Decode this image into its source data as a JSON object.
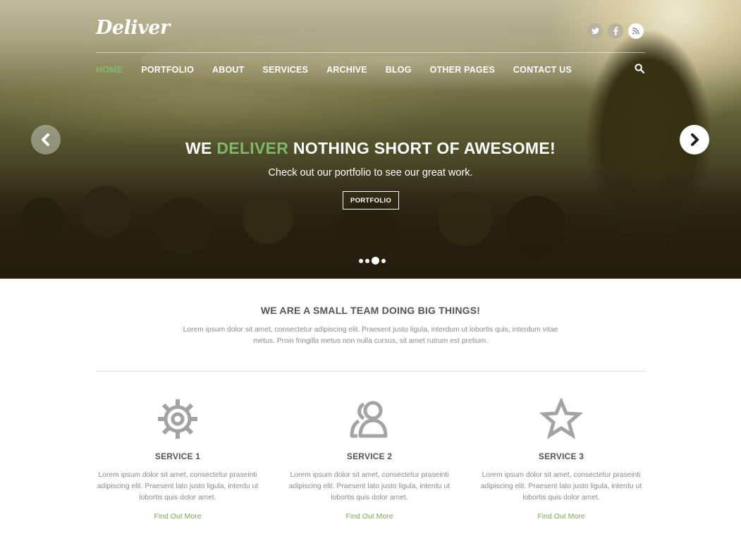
{
  "brand": {
    "logo": "Deliver"
  },
  "social": [
    {
      "icon": "twitter-icon",
      "glyph": "t"
    },
    {
      "icon": "facebook-icon",
      "glyph": "f"
    },
    {
      "icon": "rss-icon",
      "glyph": ""
    }
  ],
  "nav": {
    "items": [
      "HOME",
      "PORTFOLIO",
      "ABOUT",
      "SERVICES",
      "ARCHIVE",
      "BLOG",
      "OTHER PAGES",
      "CONTACT US"
    ],
    "active_index": 0
  },
  "hero": {
    "title_before": "WE",
    "title_accent": "DELIVER",
    "title_after": "NOTHING SHORT OF AWESOME!",
    "subtitle": "Check out our portfolio to see our great work.",
    "button": "PORTFOLIO",
    "slides_count": 4,
    "active_slide": 2
  },
  "intro": {
    "title": "WE ARE A SMALL TEAM DOING BIG THINGS!",
    "text": "Lorem ipsum dolor sit amet, consectetur adipiscing elit. Praesent justo ligula, interdum ut lobortis quis, interdum vitae metus. Proin fringilla metus non nulla cursus, sit amet rutrum est pretium."
  },
  "services": [
    {
      "icon": "gear-icon",
      "title": "SERVICE 1",
      "text": "Lorem ipsum dolor sit amet, consectetur praseinti adipiscing elit. Praesent lato justo ligula, interdu ut lobortis quis dolor amet.",
      "link": "Find Out More"
    },
    {
      "icon": "users-icon",
      "title": "SERVICE 2",
      "text": "Lorem ipsum dolor sit amet, consectetur praseinti adipiscing elit. Praesent lato justo ligula, interdu ut lobortis quis dolor amet.",
      "link": "Find Out More"
    },
    {
      "icon": "star-icon",
      "title": "SERVICE 3",
      "text": "Lorem ipsum dolor sit amet, consectetur praseinti adipiscing elit. Praesent lato justo ligula, interdu ut lobortis quis dolor amet.",
      "link": "Find Out More"
    }
  ],
  "colors": {
    "accent": "#7fb86a",
    "link": "#6fae57",
    "heading": "#555555",
    "body_text": "#8a8a8a"
  }
}
